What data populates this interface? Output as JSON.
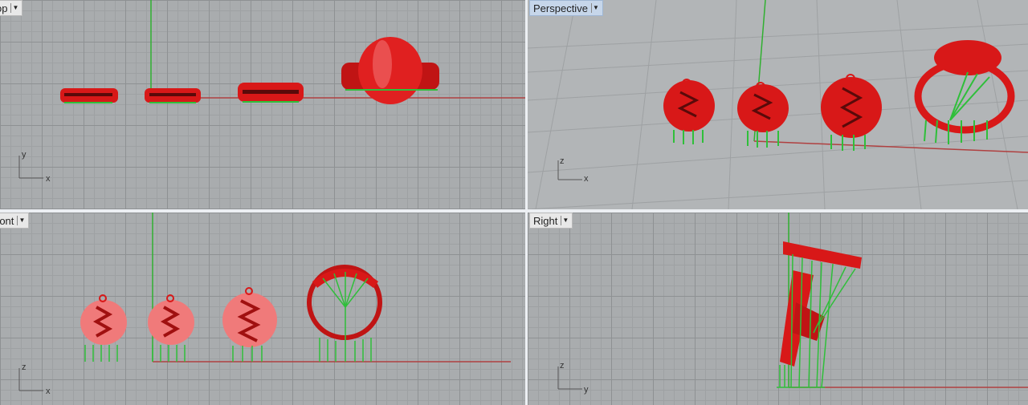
{
  "viewports": {
    "top": {
      "label": "Top",
      "shown_text": "op"
    },
    "perspective": {
      "label": "Perspective"
    },
    "front": {
      "label": "Front",
      "shown_text": "ront"
    },
    "right": {
      "label": "Right"
    }
  },
  "axes": {
    "top": {
      "vertical": "y",
      "horizontal": "x"
    },
    "perspective": {
      "vertical": "z",
      "horizontal": "x"
    },
    "front": {
      "vertical": "z",
      "horizontal": "x"
    },
    "right": {
      "vertical": "z",
      "horizontal": "y"
    }
  },
  "colors": {
    "model": "#d81818",
    "support": "#2fbf3a",
    "x_axis": "#b04040",
    "y_axis": "#30b030",
    "active_tab": "#c6d6ea"
  },
  "icons": [
    "dropdown-arrow-icon",
    "axis-widget-icon"
  ]
}
